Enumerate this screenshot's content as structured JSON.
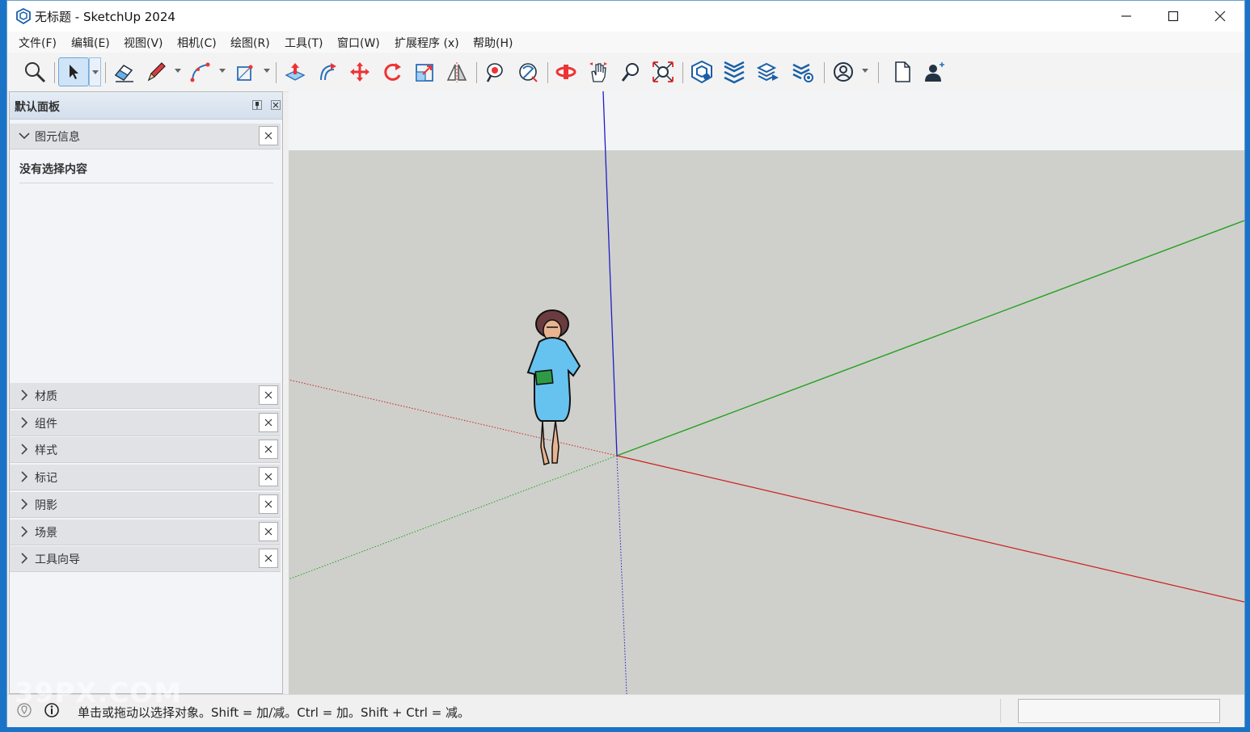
{
  "window": {
    "title": "无标题 - SketchUp 2024"
  },
  "menu": [
    {
      "label": "文件(F)"
    },
    {
      "label": "编辑(E)"
    },
    {
      "label": "视图(V)"
    },
    {
      "label": "相机(C)"
    },
    {
      "label": "绘图(R)"
    },
    {
      "label": "工具(T)"
    },
    {
      "label": "窗口(W)"
    },
    {
      "label": "扩展程序 (x)"
    },
    {
      "label": "帮助(H)"
    }
  ],
  "toolbar": {
    "tools": [
      "search-icon",
      "select-arrow-icon",
      "eraser-icon",
      "pencil-icon",
      "arc-icon",
      "rectangle-icon",
      "push-pull-icon",
      "offset-icon",
      "move-icon",
      "rotate-icon",
      "scale-icon",
      "flip-icon",
      "paint-bucket-icon",
      "tape-measure-icon",
      "orbit-icon",
      "pan-icon",
      "zoom-icon",
      "zoom-extents-icon",
      "3d-warehouse-icon",
      "extension-warehouse-icon",
      "layout-icon",
      "extension-manager-icon",
      "account-icon",
      "new-file-icon",
      "user-add-icon"
    ]
  },
  "panel": {
    "title": "默认面板",
    "entity_info": {
      "title": "图元信息",
      "empty_text": "没有选择内容"
    },
    "trays": [
      {
        "label": "材质"
      },
      {
        "label": "组件"
      },
      {
        "label": "样式"
      },
      {
        "label": "标记"
      },
      {
        "label": "阴影"
      },
      {
        "label": "场景"
      },
      {
        "label": "工具向导"
      }
    ]
  },
  "status": {
    "text": "单击或拖动以选择对象。Shift = 加/减。Ctrl = 加。Shift + Ctrl = 减。"
  },
  "watermark": "39PX.COM",
  "colors": {
    "axis_red": "#cc2020",
    "axis_green": "#1fa01f",
    "axis_blue": "#1e1ec8",
    "ground": "#cfd0cb",
    "sky": "#f3f4f6"
  }
}
